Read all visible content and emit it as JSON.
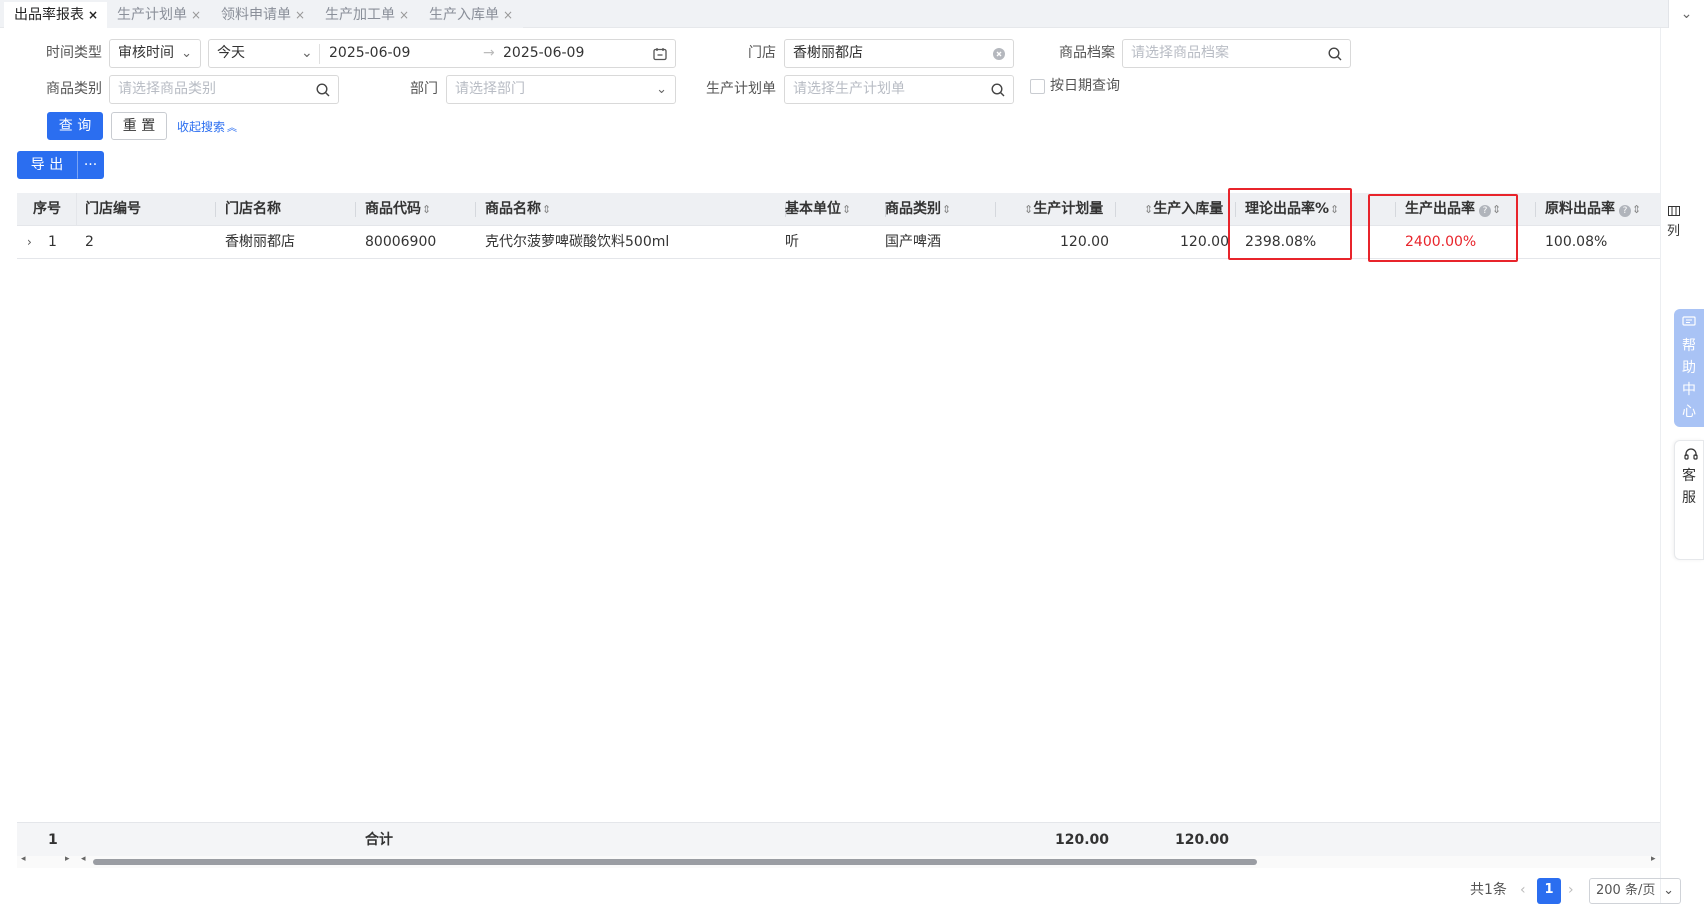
{
  "tabs": [
    {
      "label": "出品率报表",
      "active": true
    },
    {
      "label": "生产计划单",
      "active": false
    },
    {
      "label": "领料申请单",
      "active": false
    },
    {
      "label": "生产加工单",
      "active": false
    },
    {
      "label": "生产入库单",
      "active": false
    }
  ],
  "tab_close": "×",
  "tab_collapse": "⌄",
  "search": {
    "time_type_label": "时间类型",
    "time_type_value": "审核时间",
    "range_value": "今天",
    "date_start": "2025-06-09",
    "date_sep": "→",
    "date_end": "2025-06-09",
    "store_label": "门店",
    "store_value": "香榭丽都店",
    "goods_file_label": "商品档案",
    "goods_file_placeholder": "请选择商品档案",
    "goods_cat_label": "商品类别",
    "goods_cat_placeholder": "请选择商品类别",
    "dept_label": "部门",
    "dept_placeholder": "请选择部门",
    "plan_label": "生产计划单",
    "plan_placeholder": "请选择生产计划单",
    "by_date_label": "按日期查询",
    "query_btn": "查 询",
    "reset_btn": "重 置",
    "collapse_link": "收起搜索"
  },
  "toolbar": {
    "export_btn": "导 出",
    "more_btn": "···"
  },
  "table": {
    "headers": {
      "seq": "序号",
      "store_code": "门店编号",
      "store_name": "门店名称",
      "goods_code": "商品代码",
      "goods_name": "商品名称",
      "unit": "基本单位",
      "goods_cat": "商品类别",
      "plan_qty": "生产计划量",
      "in_qty": "生产入库量",
      "theory_rate": "理论出品率%",
      "prod_rate": "生产出品率",
      "material_rate": "原料出品率"
    },
    "column_menu": "列",
    "rows": [
      {
        "seq": "1",
        "store_code": "2",
        "store_name": "香榭丽都店",
        "goods_code": "80006900",
        "goods_name": "克代尔菠萝啤碳酸饮料500ml",
        "unit": "听",
        "goods_cat": "国产啤酒",
        "plan_qty": "120.00",
        "in_qty": "120.00",
        "theory_rate": "2398.08%",
        "prod_rate": "2400.00%",
        "material_rate": "100.08%"
      }
    ],
    "summary": {
      "count": "1",
      "label": "合计",
      "plan_qty": "120.00",
      "in_qty": "120.00"
    }
  },
  "pagination": {
    "total": "共1条",
    "current": "1",
    "page_size": "200 条/页"
  },
  "widgets": {
    "help": "帮助中心",
    "service": "客服"
  },
  "colors": {
    "primary": "#2b6ef0",
    "highlight": "#e8242b"
  }
}
